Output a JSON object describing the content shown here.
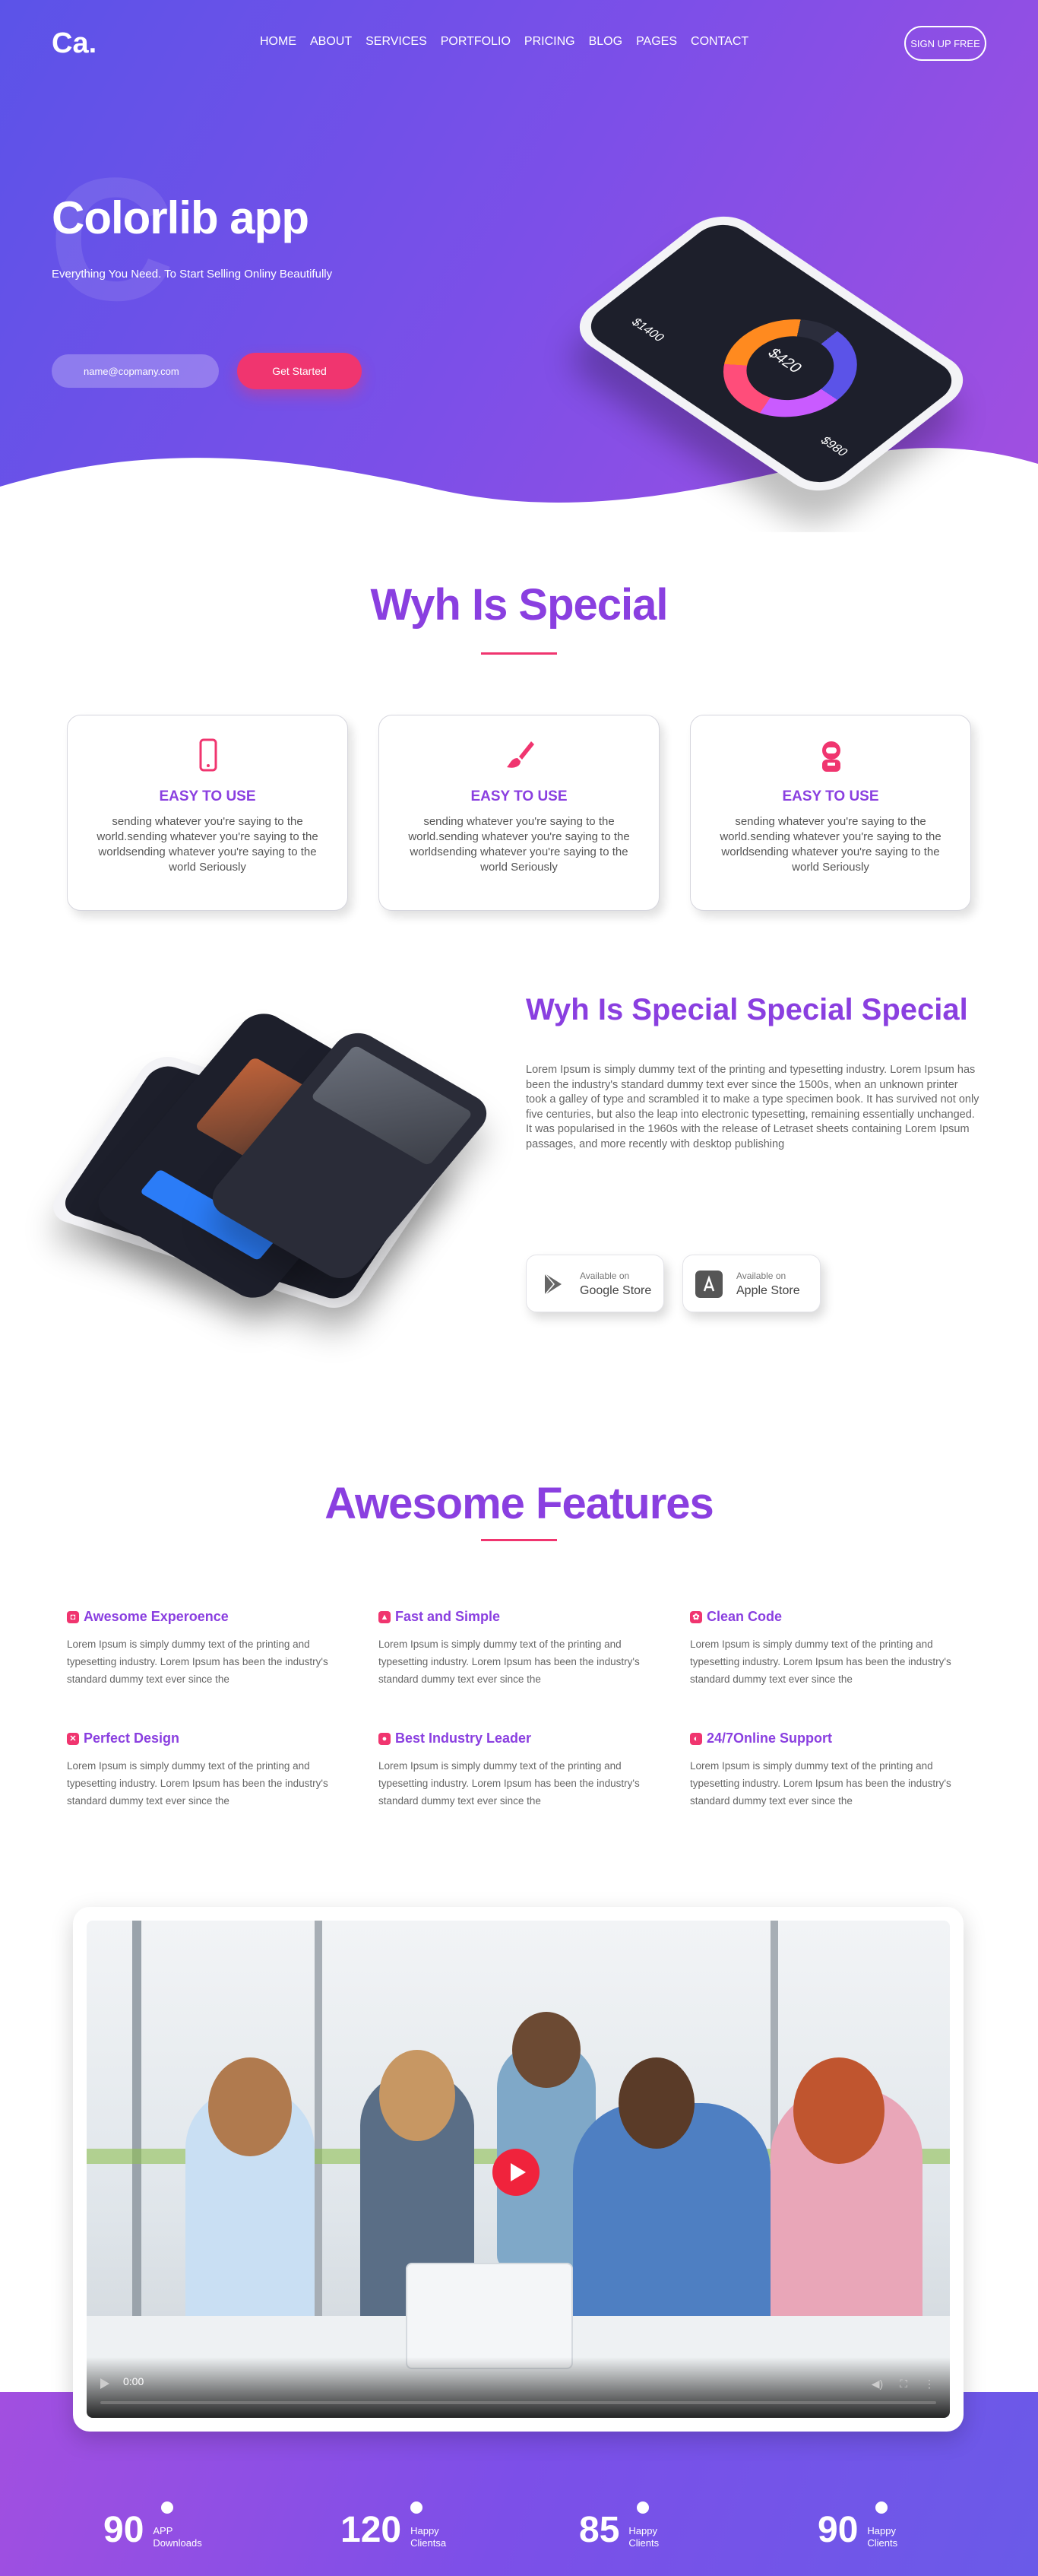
{
  "header": {
    "logo": "Ca.",
    "nav": [
      "HOME",
      "ABOUT",
      "SERVICES",
      "PORTFOLIO",
      "PRICING",
      "BLOG",
      "PAGES",
      "CONTACT"
    ],
    "signup": "SIGN UP FREE"
  },
  "hero": {
    "title": "Colorlib app",
    "subtitle": "Everything You Need. To Start Selling Onliny Beautifully",
    "email_placeholder": "name@copmany.com",
    "cta": "Get Started",
    "phone": {
      "main_value": "$420",
      "value_a": "$980",
      "value_b": "$1400"
    }
  },
  "special": {
    "title": "Wyh Is Special",
    "cards": [
      {
        "title": "EASY TO USE",
        "text": "sending whatever you're saying to the world.sending whatever you're saying to the worldsending whatever you're saying to the world Seriously"
      },
      {
        "title": "EASY TO USE",
        "text": "sending whatever you're saying to the world.sending whatever you're saying to the worldsending whatever you're saying to the world Seriously"
      },
      {
        "title": "EASY TO USE",
        "text": "sending whatever you're saying to the world.sending whatever you're saying to the worldsending whatever you're saying to the world Seriously"
      }
    ]
  },
  "about": {
    "title": "Wyh Is Special Special Special",
    "text": "Lorem Ipsum is simply dummy text of the printing and typesetting industry. Lorem Ipsum has been the industry's standard dummy text ever since the 1500s, when an unknown printer took a galley of type and scrambled it to make a type specimen book. It has survived not only five centuries, but also the leap into electronic typesetting, remaining essentially unchanged. It was popularised in the 1960s with the release of Letraset sheets containing Lorem Ipsum passages, and more recently with desktop publishing",
    "google": {
      "small": "Available on",
      "big": "Google Store"
    },
    "apple": {
      "small": "Available on",
      "big": "Apple Store"
    }
  },
  "features": {
    "title": "Awesome Features",
    "items": [
      {
        "title": "Awesome Experoence",
        "text": "Lorem Ipsum is simply dummy text of the printing and typesetting industry. Lorem Ipsum has been the industry's standard dummy text ever since the"
      },
      {
        "title": "Fast and Simple",
        "text": "Lorem Ipsum is simply dummy text of the printing and typesetting industry. Lorem Ipsum has been the industry's standard dummy text ever since the"
      },
      {
        "title": "Clean Code",
        "text": "Lorem Ipsum is simply dummy text of the printing and typesetting industry. Lorem Ipsum has been the industry's standard dummy text ever since the"
      },
      {
        "title": "Perfect Design",
        "text": "Lorem Ipsum is simply dummy text of the printing and typesetting industry. Lorem Ipsum has been the industry's standard dummy text ever since the"
      },
      {
        "title": "Best Industry Leader",
        "text": "Lorem Ipsum is simply dummy text of the printing and typesetting industry. Lorem Ipsum has been the industry's standard dummy text ever since the"
      },
      {
        "title": "24/7Online Support",
        "text": "Lorem Ipsum is simply dummy text of the printing and typesetting industry. Lorem Ipsum has been the industry's standard dummy text ever since the"
      }
    ]
  },
  "video": {
    "time": "0:00"
  },
  "stats": [
    {
      "num": "90",
      "label1": "APP",
      "label2": "Downloads"
    },
    {
      "num": "120",
      "label1": "Happy",
      "label2": "Clientsa"
    },
    {
      "num": "85",
      "label1": "Happy",
      "label2": "Clients"
    },
    {
      "num": "90",
      "label1": "Happy",
      "label2": "Clients"
    }
  ],
  "colors": {
    "primary": "#8a3fe0",
    "accent": "#f0356f",
    "hero_start": "#5b53e8",
    "hero_end": "#a24fe0"
  }
}
